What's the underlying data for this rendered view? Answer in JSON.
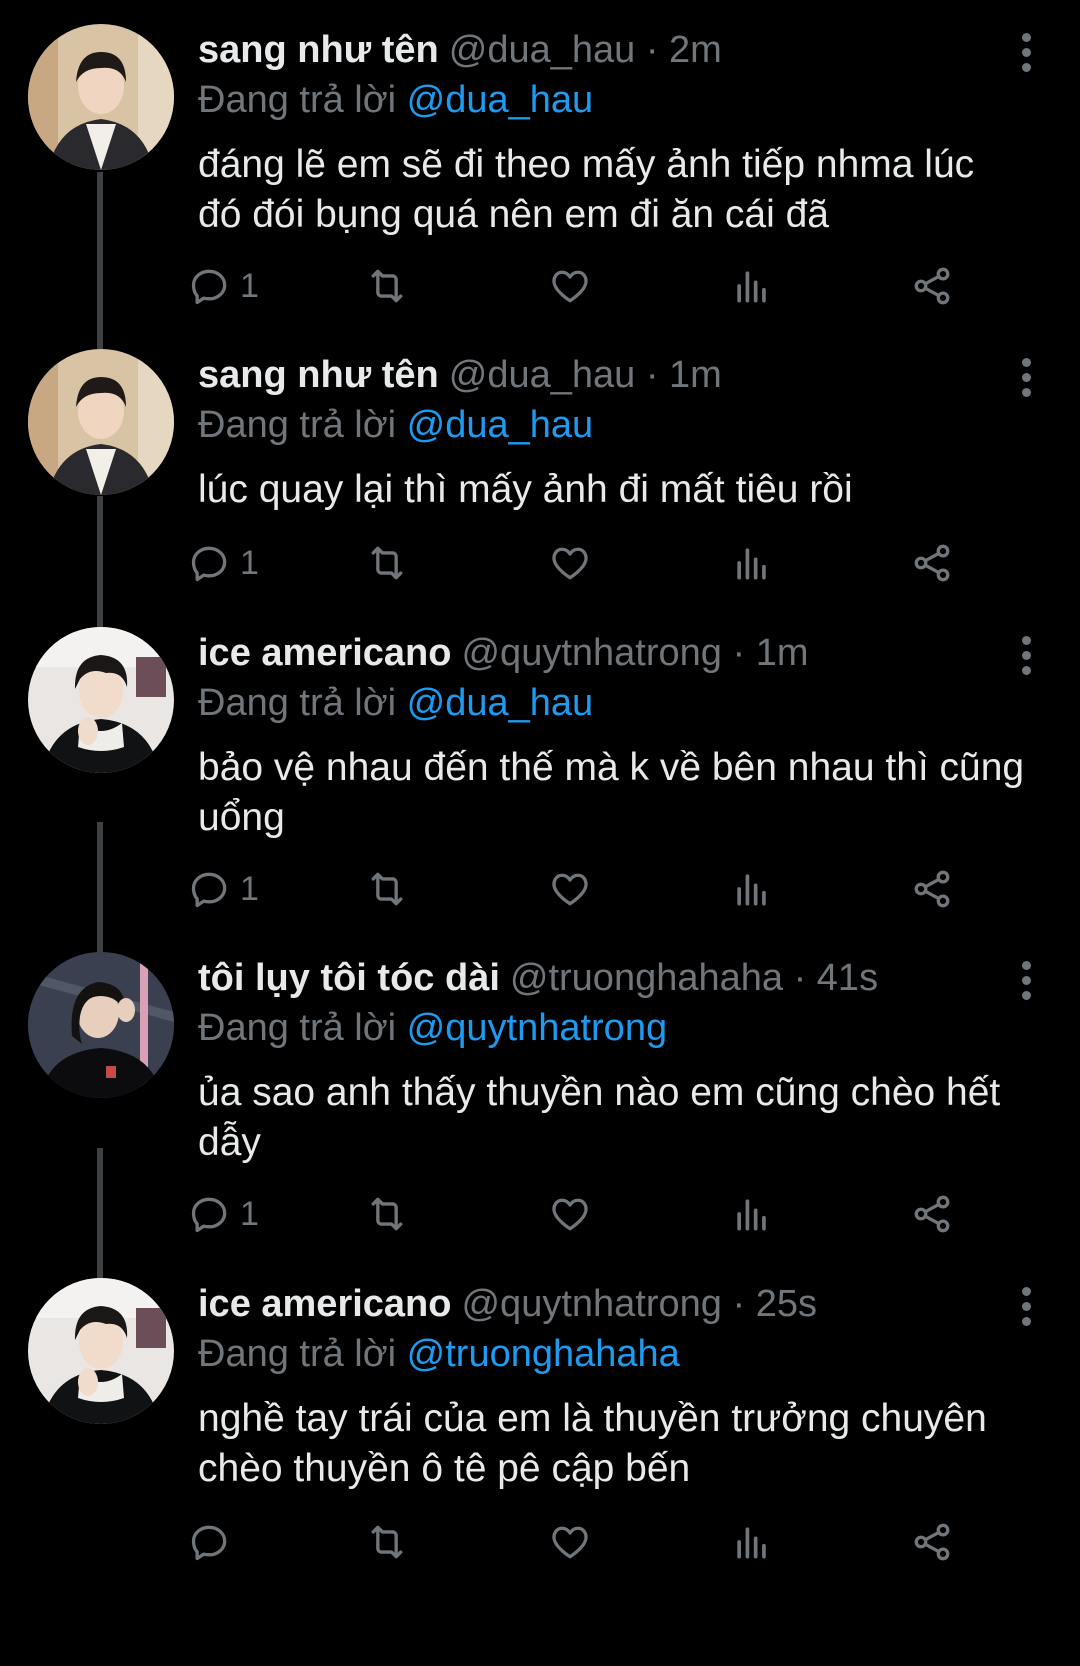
{
  "replying_prefix": "Đang trả lời",
  "tweets": [
    {
      "name": "sang như tên",
      "handle": "@dua_hau",
      "sep": "·",
      "time": "2m",
      "replying_to": "@dua_hau",
      "text": "đáng lẽ em sẽ đi theo mấy ảnh tiếp nhma lúc đó đói bụng quá nên em đi ăn cái đã",
      "reply_count": "1"
    },
    {
      "name": "sang như tên",
      "handle": "@dua_hau",
      "sep": "·",
      "time": "1m",
      "replying_to": "@dua_hau",
      "text": "lúc quay lại thì mấy ảnh đi mất tiêu rồi",
      "reply_count": "1"
    },
    {
      "name": "ice americano",
      "handle": "@quytnhatrong",
      "sep": "·",
      "time": "1m",
      "replying_to": "@dua_hau",
      "text": "bảo vệ nhau đến thế mà k về bên nhau thì cũng uổng",
      "reply_count": "1"
    },
    {
      "name": "tôi lụy tôi tóc dài",
      "handle": "@truonghahaha",
      "sep": "·",
      "time": "41s",
      "replying_to": "@quytnhatrong",
      "text": "ủa sao anh thấy thuyền nào em cũng chèo hết dẫy",
      "reply_count": "1"
    },
    {
      "name": "ice americano",
      "handle": "@quytnhatrong",
      "sep": "·",
      "time": "25s",
      "replying_to": "@truonghahaha",
      "text": "nghề tay trái của em là thuyền trưởng chuyên chèo thuyền ô tê pê cập bến",
      "reply_count": ""
    }
  ],
  "icons": {
    "reply": "reply-icon",
    "retweet": "retweet-icon",
    "like": "heart-icon",
    "views": "analytics-icon",
    "share": "share-icon",
    "more": "more-options-icon"
  },
  "colors": {
    "background": "#000000",
    "text": "#e7e9ea",
    "muted": "#71767b",
    "link": "#1d9bf0",
    "thread_line": "#3d4144"
  }
}
